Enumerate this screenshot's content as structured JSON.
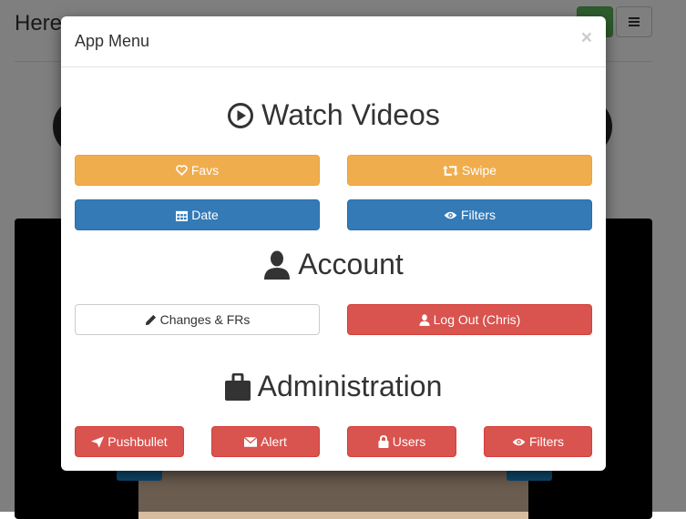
{
  "background": {
    "page_title": "Here"
  },
  "modal": {
    "title": "App Menu",
    "close_symbol": "×",
    "watch": {
      "heading": "Watch Videos",
      "icon": "play-circle-icon",
      "buttons": [
        {
          "label": "Favs",
          "icon": "heart-icon",
          "style": "warning"
        },
        {
          "label": "Swipe",
          "icon": "retweet-icon",
          "style": "warning"
        },
        {
          "label": "Date",
          "icon": "calendar-icon",
          "style": "primary"
        },
        {
          "label": "Filters",
          "icon": "eye-icon",
          "style": "primary"
        }
      ]
    },
    "account": {
      "heading": "Account",
      "icon": "user-icon",
      "buttons": [
        {
          "label": "Changes & FRs",
          "icon": "pencil-icon",
          "style": "default"
        },
        {
          "label": "Log Out (Chris)",
          "icon": "user-icon",
          "style": "danger"
        }
      ]
    },
    "admin": {
      "heading": "Administration",
      "icon": "briefcase-icon",
      "buttons": [
        {
          "label": "Pushbullet",
          "icon": "send-icon",
          "style": "danger"
        },
        {
          "label": "Alert",
          "icon": "envelope-icon",
          "style": "danger"
        },
        {
          "label": "Users",
          "icon": "lock-icon",
          "style": "danger"
        },
        {
          "label": "Filters",
          "icon": "eye-icon",
          "style": "danger"
        }
      ]
    }
  },
  "colors": {
    "warning": "#f0ad4e",
    "primary": "#337ab7",
    "danger": "#d9534f",
    "success": "#5cb85c"
  }
}
